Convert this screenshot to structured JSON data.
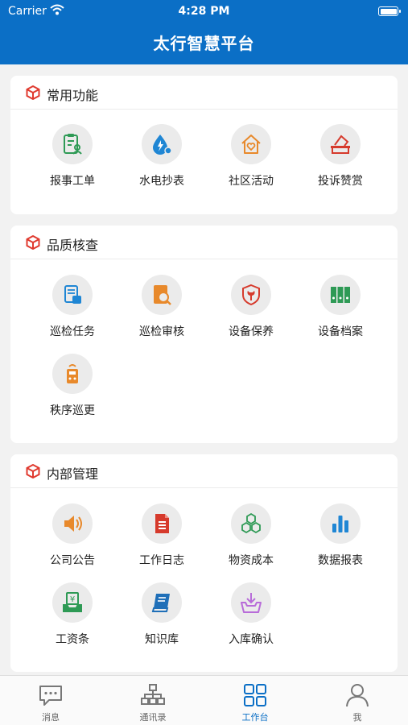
{
  "status": {
    "carrier": "Carrier",
    "time": "4:28 PM"
  },
  "header": {
    "title": "太行智慧平台"
  },
  "sections": [
    {
      "title": "常用功能",
      "items": [
        {
          "label": "报事工单",
          "icon": "clipboard-user-icon"
        },
        {
          "label": "水电抄表",
          "icon": "water-drop-icon"
        },
        {
          "label": "社区活动",
          "icon": "house-heart-icon"
        },
        {
          "label": "投诉赞赏",
          "icon": "ballot-box-icon"
        }
      ]
    },
    {
      "title": "品质核查",
      "items": [
        {
          "label": "巡检任务",
          "icon": "inspection-task-icon"
        },
        {
          "label": "巡检审核",
          "icon": "audit-search-icon"
        },
        {
          "label": "设备保养",
          "icon": "shield-wrench-icon"
        },
        {
          "label": "设备档案",
          "icon": "binders-icon"
        },
        {
          "label": "秩序巡更",
          "icon": "patrol-device-icon"
        }
      ]
    },
    {
      "title": "内部管理",
      "items": [
        {
          "label": "公司公告",
          "icon": "speaker-icon"
        },
        {
          "label": "工作日志",
          "icon": "document-icon"
        },
        {
          "label": "物资成本",
          "icon": "cubes-icon"
        },
        {
          "label": "数据报表",
          "icon": "bar-chart-icon"
        },
        {
          "label": "工资条",
          "icon": "salary-tray-icon"
        },
        {
          "label": "知识库",
          "icon": "book-icon"
        },
        {
          "label": "入库确认",
          "icon": "inbox-download-icon"
        }
      ]
    }
  ],
  "tabbar": [
    {
      "label": "消息",
      "icon": "chat-bubble-icon",
      "active": false
    },
    {
      "label": "通讯录",
      "icon": "org-chart-icon",
      "active": false
    },
    {
      "label": "工作台",
      "icon": "grid-icon",
      "active": true
    },
    {
      "label": "我",
      "icon": "person-icon",
      "active": false
    }
  ],
  "colors": {
    "primary": "#0b6fc6",
    "section_icon": "#e03a2f",
    "background": "#f2f2f2"
  }
}
